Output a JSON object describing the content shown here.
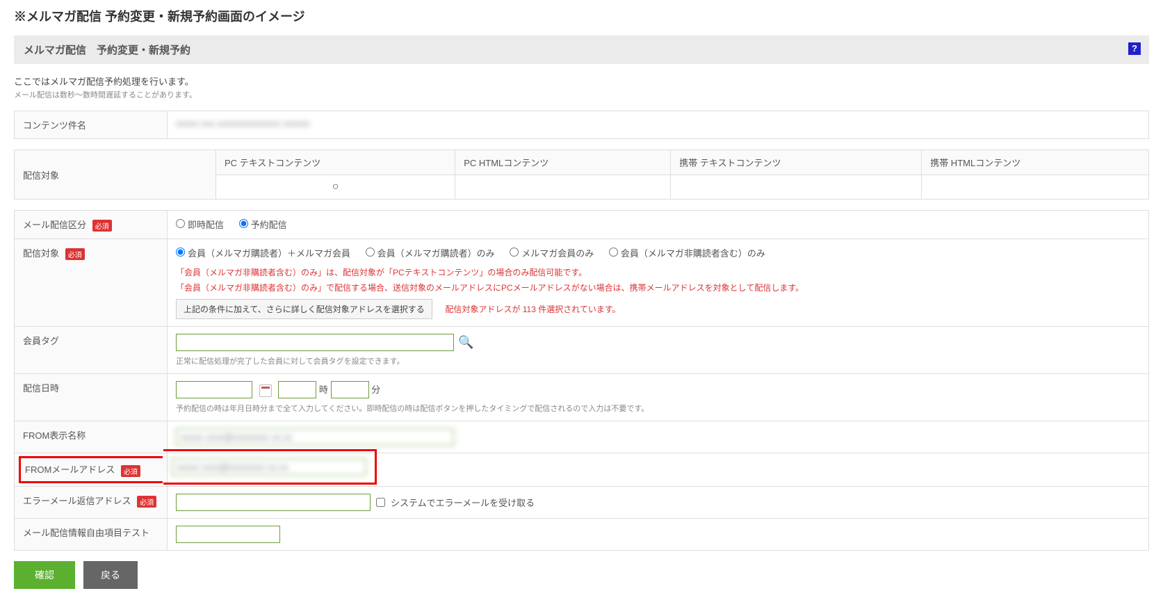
{
  "page_title": "※メルマガ配信 予約変更・新規予約画面のイメージ",
  "section_header": "メルマガ配信　予約変更・新規予約",
  "help_icon": "?",
  "intro_text": "ここではメルマガ配信予約処理を行います。",
  "intro_note": "メール配信は数秒～数時間遅延することがあります。",
  "content_name_label": "コンテンツ件名",
  "content_name_value": "xxxxx xxx xxxxxxxxxxxxxx xxxxxx",
  "target_table": {
    "row_label": "配信対象",
    "headers": [
      "PC テキストコンテンツ",
      "PC HTMLコンテンツ",
      "携帯 テキストコンテンツ",
      "携帯 HTMLコンテンツ"
    ],
    "selected_mark": "○"
  },
  "required_badge": "必須",
  "rows": {
    "delivery_type": {
      "label": "メール配信区分",
      "options": [
        "即時配信",
        "予約配信"
      ]
    },
    "target": {
      "label": "配信対象",
      "options": [
        "会員（メルマガ購読者）＋メルマガ会員",
        "会員（メルマガ購読者）のみ",
        "メルマガ会員のみ",
        "会員（メルマガ非購読者含む）のみ"
      ],
      "warning1": "「会員（メルマガ非購読者含む）のみ」は、配信対象が「PCテキストコンテンツ」の場合のみ配信可能です。",
      "warning2": "「会員（メルマガ非購読者含む）のみ」で配信する場合、送信対象のメールアドレスにPCメールアドレスがない場合は、携帯メールアドレスを対象として配信します。",
      "btn_refine": "上記の条件に加えて、さらに詳しく配信対象アドレスを選択する",
      "status": "配信対象アドレスが 113 件選択されています。"
    },
    "member_tag": {
      "label": "会員タグ",
      "note": "正常に配信処理が完了した会員に対して会員タグを設定できます。"
    },
    "delivery_date": {
      "label": "配信日時",
      "hour_suffix": "時",
      "min_suffix": "分",
      "note": "予約配信の時は年月日時分まで全て入力してください。即時配信の時は配信ボタンを押したタイミングで配信されるので入力は不要です。"
    },
    "from_name": {
      "label": "FROM表示名称",
      "value": "xxxxx xxxx@xxxxxxxx xx.xx"
    },
    "from_email": {
      "label": "FROMメールアドレス",
      "value": "xxxxx xxxx@xxxxxxxx xx.xx"
    },
    "error_reply": {
      "label": "エラーメール返信アドレス",
      "checkbox_label": "システムでエラーメールを受け取る"
    },
    "free_item": {
      "label": "メール配信情報自由項目テスト"
    }
  },
  "buttons": {
    "confirm": "確認",
    "back": "戻る"
  }
}
